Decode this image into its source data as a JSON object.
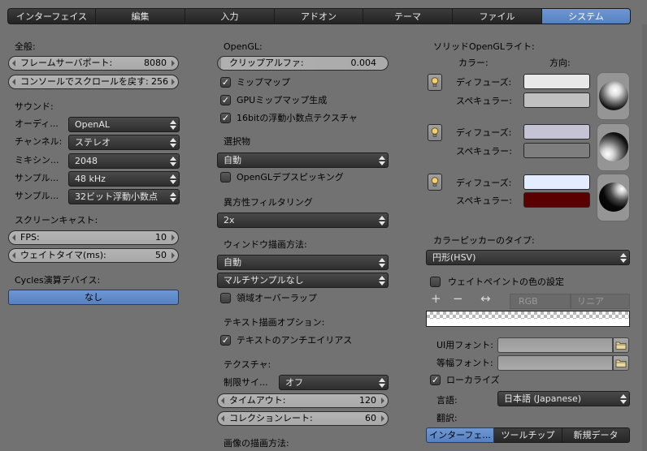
{
  "tabs": [
    {
      "label": "インターフェイス",
      "active": false
    },
    {
      "label": "編集",
      "active": false
    },
    {
      "label": "入力",
      "active": false
    },
    {
      "label": "アドオン",
      "active": false
    },
    {
      "label": "テーマ",
      "active": false
    },
    {
      "label": "ファイル",
      "active": false
    },
    {
      "label": "システム",
      "active": true
    }
  ],
  "general": {
    "heading": "全般:",
    "frame_server_label": "フレームサーバポート:",
    "frame_server_value": "8080",
    "console_scroll_label": "コンソールでスクロールを戻す:",
    "console_scroll_value": "256"
  },
  "sound": {
    "heading": "サウンド:",
    "rows": [
      {
        "label": "オーディ...",
        "value": "OpenAL"
      },
      {
        "label": "チャンネル:",
        "value": "ステレオ"
      },
      {
        "label": "ミキシン...",
        "value": "2048"
      },
      {
        "label": "サンプル...",
        "value": "48 kHz"
      },
      {
        "label": "サンプル...",
        "value": "32ビット浮動小数点"
      }
    ]
  },
  "screencast": {
    "heading": "スクリーンキャスト:",
    "fps_label": "FPS:",
    "fps_value": "10",
    "wait_label": "ウェイトタイマ(ms):",
    "wait_value": "50"
  },
  "cycles": {
    "heading": "Cycles演算デバイス:",
    "button": "なし"
  },
  "opengl": {
    "heading": "OpenGL:",
    "clip_alpha_label": "クリップアルファ:",
    "clip_alpha_value": "0.004",
    "mipmap_label": "ミップマップ",
    "mipmap_checked": true,
    "gpu_mipmap_label": "GPUミップマップ生成",
    "gpu_mipmap_checked": true,
    "float_tex_label": "16bitの浮動小数点テクスチャ",
    "float_tex_checked": true
  },
  "selection": {
    "heading": "選択物",
    "value": "自動",
    "depth_pick_label": "OpenGLデプスピッキング",
    "depth_pick_checked": false
  },
  "anisotropic": {
    "heading": "異方性フィルタリング",
    "value": "2x"
  },
  "window_draw": {
    "heading": "ウィンドウ描画方法:",
    "method": "自動",
    "multisample": "マルチサンプルなし",
    "overlap_label": "領域オーバーラップ",
    "overlap_checked": false
  },
  "text_draw": {
    "heading": "テキスト描画オプション:",
    "antialias_label": "テキストのアンチエイリアス",
    "antialias_checked": true
  },
  "textures": {
    "heading": "テクスチャ:",
    "limit_label": "制限サイ...",
    "limit_value": "オフ",
    "timeout_label": "タイムアウト:",
    "timeout_value": "120",
    "collection_label": "コレクションレート:",
    "collection_value": "60",
    "image_draw_heading": "画像の描画方法:"
  },
  "solid_lights": {
    "heading": "ソリッドOpenGLライト:",
    "color_header": "カラー:",
    "direction_header": "方向:",
    "diffuse_label": "ディフューズ:",
    "specular_label": "スペキュラー:",
    "lights": [
      {
        "diffuse": "#e8e8e8",
        "specular": "#c0c0c0"
      },
      {
        "diffuse": "#c4c4d4",
        "specular": "#7e7e7e"
      },
      {
        "diffuse": "#e4ecff",
        "specular": "#5a0000"
      }
    ]
  },
  "color_picker": {
    "heading": "カラーピッカーのタイプ:",
    "value": "円形(HSV)",
    "weight_paint_label": "ウェイトペイントの色の設定",
    "weight_paint_checked": false,
    "plus": "+",
    "minus": "−",
    "arrows": "↔",
    "mode": "RGB",
    "interp": "リニア"
  },
  "fonts": {
    "ui_font_label": "UI用フォント:",
    "mono_font_label": "等幅フォント:",
    "localize_label": "ローカライズ",
    "localize_checked": true,
    "language_label": "言語:",
    "language_value": "日本語 (Japanese)",
    "translate_label": "翻訳:",
    "translate_buttons": [
      {
        "label": "インターフェ...",
        "active": true
      },
      {
        "label": "ツールチップ",
        "active": false
      },
      {
        "label": "新規データ",
        "active": false
      }
    ]
  },
  "colors": {
    "accent": "#5f8bcd",
    "panel": "#727272",
    "dark_widget": "#333333",
    "num_field": "#aeaeae"
  }
}
